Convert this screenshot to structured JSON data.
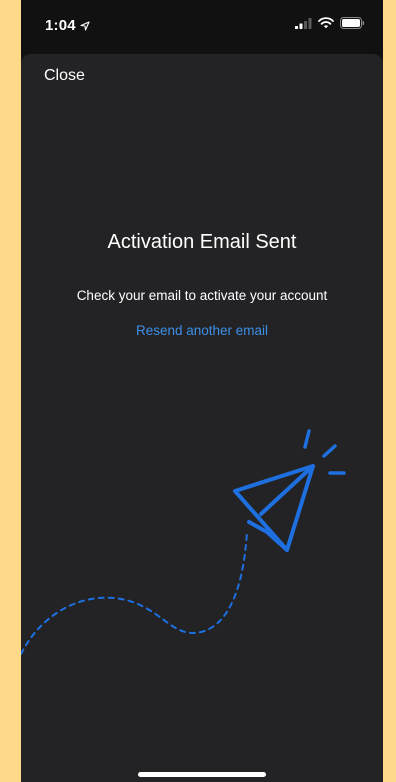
{
  "status_bar": {
    "time": "1:04",
    "icons": [
      "location-arrow-icon",
      "cellular-signal-icon",
      "wifi-icon",
      "battery-icon"
    ]
  },
  "sheet": {
    "close_label": "Close",
    "title": "Activation Email Sent",
    "subtitle": "Check your email to activate your account",
    "resend_label": "Resend another email",
    "illustration": "paper-plane-icon"
  },
  "colors": {
    "background": "#FFD98A",
    "status_bar": "#111111",
    "sheet": "#232325",
    "text": "#FFFFFF",
    "link": "#3C8FE6",
    "plane": "#1E6FE0"
  }
}
